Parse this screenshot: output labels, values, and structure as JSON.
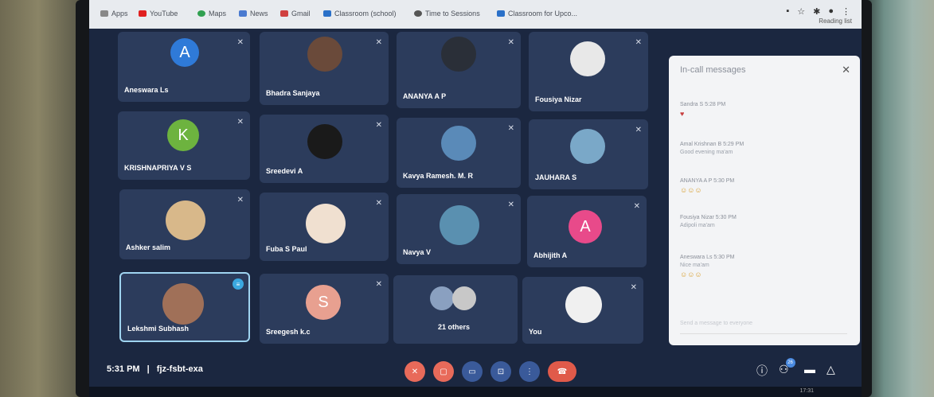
{
  "browser": {
    "bookmarks": [
      "Apps",
      "YouTube",
      "Maps",
      "News",
      "Gmail",
      "Classroom (school)",
      "Time to Sessions",
      "Classroom for Upco..."
    ],
    "reading_list": "Reading list"
  },
  "tiles": [
    {
      "name": "Aneswara Ls",
      "initial": "A",
      "color": "#2f7ad8"
    },
    {
      "name": "Bhadra Sanjaya",
      "initial": "",
      "color": "#6a4a3a"
    },
    {
      "name": "ANANYA A P",
      "initial": "",
      "color": "#2a2f38"
    },
    {
      "name": "Fousiya Nizar",
      "initial": "",
      "color": "#e8e8e8"
    },
    {
      "name": "KRISHNAPRIYA V S",
      "initial": "K",
      "color": "#6db33f"
    },
    {
      "name": "Sreedevi A",
      "initial": "",
      "color": "#1a1a1a"
    },
    {
      "name": "Kavya Ramesh. M. R",
      "initial": "",
      "color": "#5a8ab8"
    },
    {
      "name": "JAUHARA S",
      "initial": "",
      "color": "#7aa8c8"
    },
    {
      "name": "Ashker salim",
      "initial": "",
      "color": "#d8b88a"
    },
    {
      "name": "Fuba S Paul",
      "initial": "",
      "color": "#f0e0d0"
    },
    {
      "name": "Navya V",
      "initial": "",
      "color": "#5a90b0"
    },
    {
      "name": "Abhijith A",
      "initial": "A",
      "color": "#e84a8a"
    },
    {
      "name": "Lekshmi Subhash",
      "initial": "",
      "color": "#a07058"
    },
    {
      "name": "Sreegesh k.c",
      "initial": "S",
      "color": "#e8a090"
    },
    {
      "name": "21 others",
      "initial": "",
      "color": "#8aa0c0"
    },
    {
      "name": "You",
      "initial": "",
      "color": "#f0f0f0"
    }
  ],
  "panel": {
    "title": "In-call messages",
    "messages": [
      {
        "sender": "Sandra S 5:28 PM",
        "body": ""
      },
      {
        "sender": "Amal Krishnan B 5:29 PM",
        "body": "Good evening ma'am"
      },
      {
        "sender": "ANANYA A P 5:30 PM",
        "body": ""
      },
      {
        "sender": "Fousiya Nizar 5:30 PM",
        "body": "Adipoli ma'am"
      },
      {
        "sender": "Aneswara Ls 5:30 PM",
        "body": "Nice ma'am"
      }
    ],
    "input_placeholder": "Send a message to everyone"
  },
  "footer": {
    "time": "5:31 PM",
    "separator": "|",
    "meeting_code": "fjz-fsbt-exa",
    "participants_badge": "26"
  },
  "taskbar": {
    "clock": "17:31"
  },
  "colors": {
    "meet_bg": "#1b2740",
    "tile_bg": "#2c3c5c",
    "end_call": "#e05a4a",
    "muted_control": "#e86a5a",
    "active_control": "#3a5a9a"
  }
}
